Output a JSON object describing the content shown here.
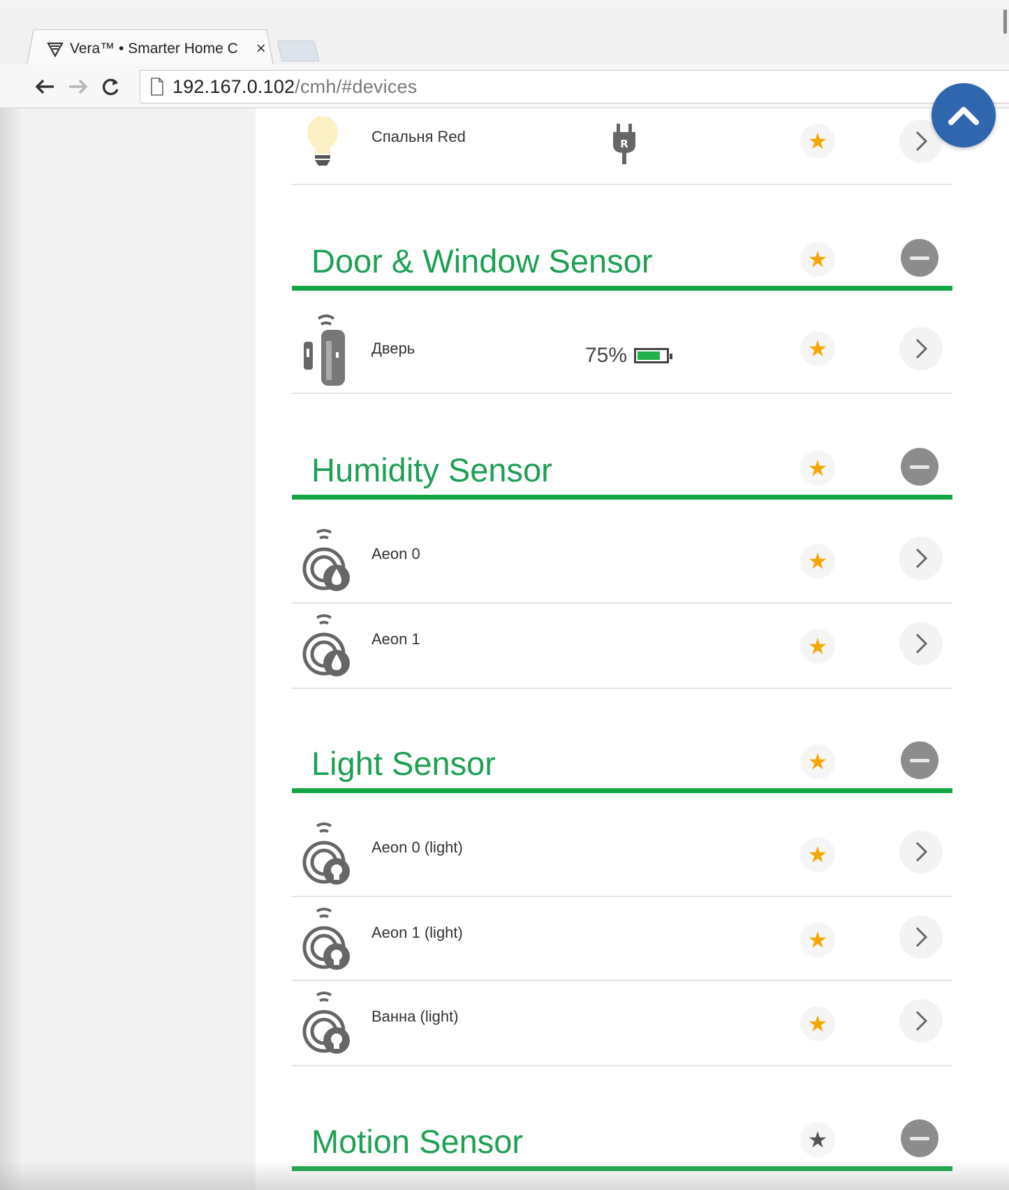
{
  "browser": {
    "tab_title": "Vera™ • Smarter Home C",
    "tab_close": "×",
    "url_host": "192.167.0.102",
    "url_path": "/cmh/#devices"
  },
  "colors": {
    "accent_green": "#14a545",
    "header_text_green": "#1f9f55",
    "star_active": "#f2a800",
    "star_inactive": "#555555",
    "scroll_button": "#2f66ad"
  },
  "devices_top": [
    {
      "name": "Спальня Red",
      "icon": "bulb-icon",
      "extra_icon": "plug-icon",
      "favorite": true
    }
  ],
  "sections": [
    {
      "title": "Door & Window Sensor",
      "favorite": true,
      "devices": [
        {
          "name": "Дверь",
          "icon": "door-sensor-icon",
          "battery": "75%",
          "battery_level": 0.75,
          "favorite": true
        }
      ]
    },
    {
      "title": "Humidity Sensor",
      "favorite": true,
      "devices": [
        {
          "name": "Aeon 0",
          "icon": "humidity-sensor-icon",
          "favorite": true
        },
        {
          "name": "Aeon 1",
          "icon": "humidity-sensor-icon",
          "favorite": true
        }
      ]
    },
    {
      "title": "Light Sensor",
      "favorite": true,
      "devices": [
        {
          "name": "Aeon 0 (light)",
          "icon": "light-sensor-icon",
          "favorite": true
        },
        {
          "name": "Aeon 1 (light)",
          "icon": "light-sensor-icon",
          "favorite": true
        },
        {
          "name": "Ванна (light)",
          "icon": "light-sensor-icon",
          "favorite": true
        }
      ]
    },
    {
      "title": "Motion Sensor",
      "favorite": false,
      "devices": []
    }
  ],
  "icons": {
    "star": "★",
    "back": "back-arrow-icon",
    "forward": "forward-arrow-icon",
    "reload": "reload-icon",
    "scroll_top": "chevron-up-icon",
    "row_arrow": "chevron-right-icon",
    "collapse": "minus-icon"
  }
}
